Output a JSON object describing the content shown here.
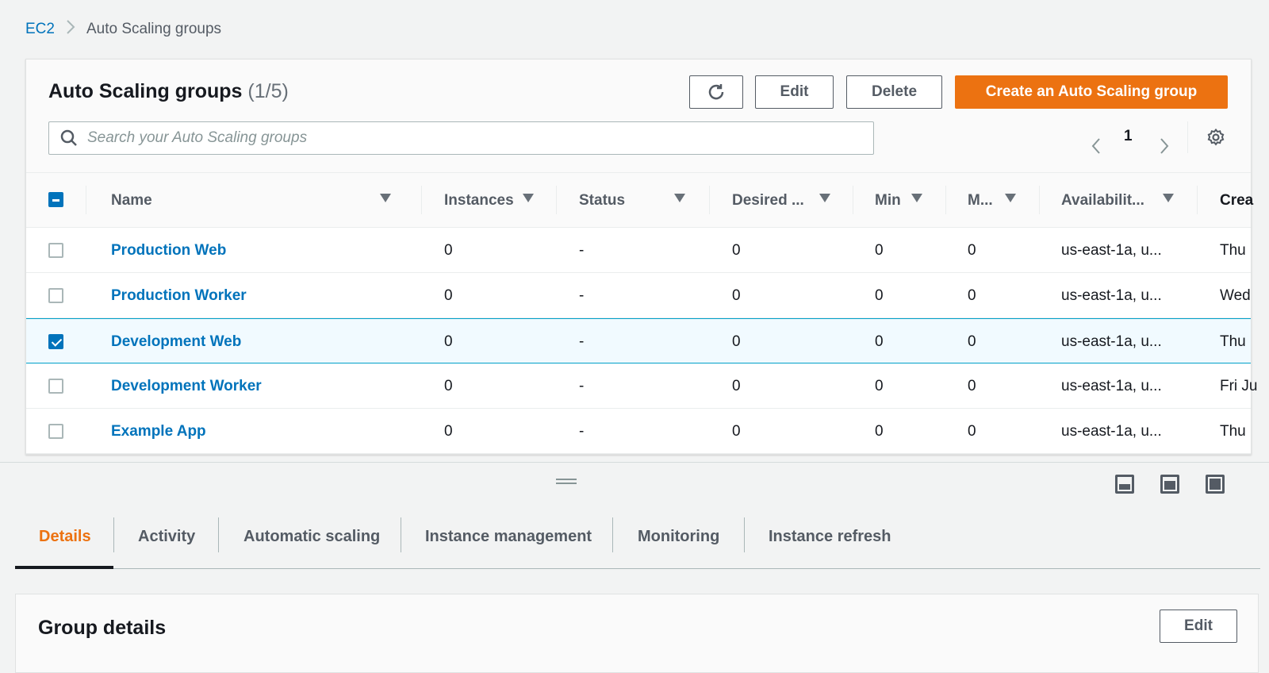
{
  "breadcrumb": {
    "root": "EC2",
    "current": "Auto Scaling groups"
  },
  "panel": {
    "title": "Auto Scaling groups",
    "count": "(1/5)",
    "edit": "Edit",
    "delete": "Delete",
    "create": "Create an Auto Scaling group",
    "search_placeholder": "Search your Auto Scaling groups",
    "page": "1"
  },
  "columns": [
    "Name",
    "Instances",
    "Status",
    "Desired ...",
    "Min",
    "M...",
    "Availabilit...",
    "Crea"
  ],
  "rows": [
    {
      "name": "Production Web",
      "instances": "0",
      "status": "-",
      "desired": "0",
      "min": "0",
      "max": "0",
      "az": "us-east-1a, u...",
      "created": "Thu",
      "selected": false
    },
    {
      "name": "Production Worker",
      "instances": "0",
      "status": "-",
      "desired": "0",
      "min": "0",
      "max": "0",
      "az": "us-east-1a, u...",
      "created": "Wed",
      "selected": false
    },
    {
      "name": "Development Web",
      "instances": "0",
      "status": "-",
      "desired": "0",
      "min": "0",
      "max": "0",
      "az": "us-east-1a, u...",
      "created": "Thu",
      "selected": true
    },
    {
      "name": "Development Worker",
      "instances": "0",
      "status": "-",
      "desired": "0",
      "min": "0",
      "max": "0",
      "az": "us-east-1a, u...",
      "created": "Fri Ju",
      "selected": false
    },
    {
      "name": "Example App",
      "instances": "0",
      "status": "-",
      "desired": "0",
      "min": "0",
      "max": "0",
      "az": "us-east-1a, u...",
      "created": "Thu",
      "selected": false
    }
  ],
  "tabs": [
    "Details",
    "Activity",
    "Automatic scaling",
    "Instance management",
    "Monitoring",
    "Instance refresh"
  ],
  "details": {
    "title": "Group details",
    "edit": "Edit"
  },
  "colors": {
    "accent": "#ec7211",
    "link": "#0073bb"
  }
}
